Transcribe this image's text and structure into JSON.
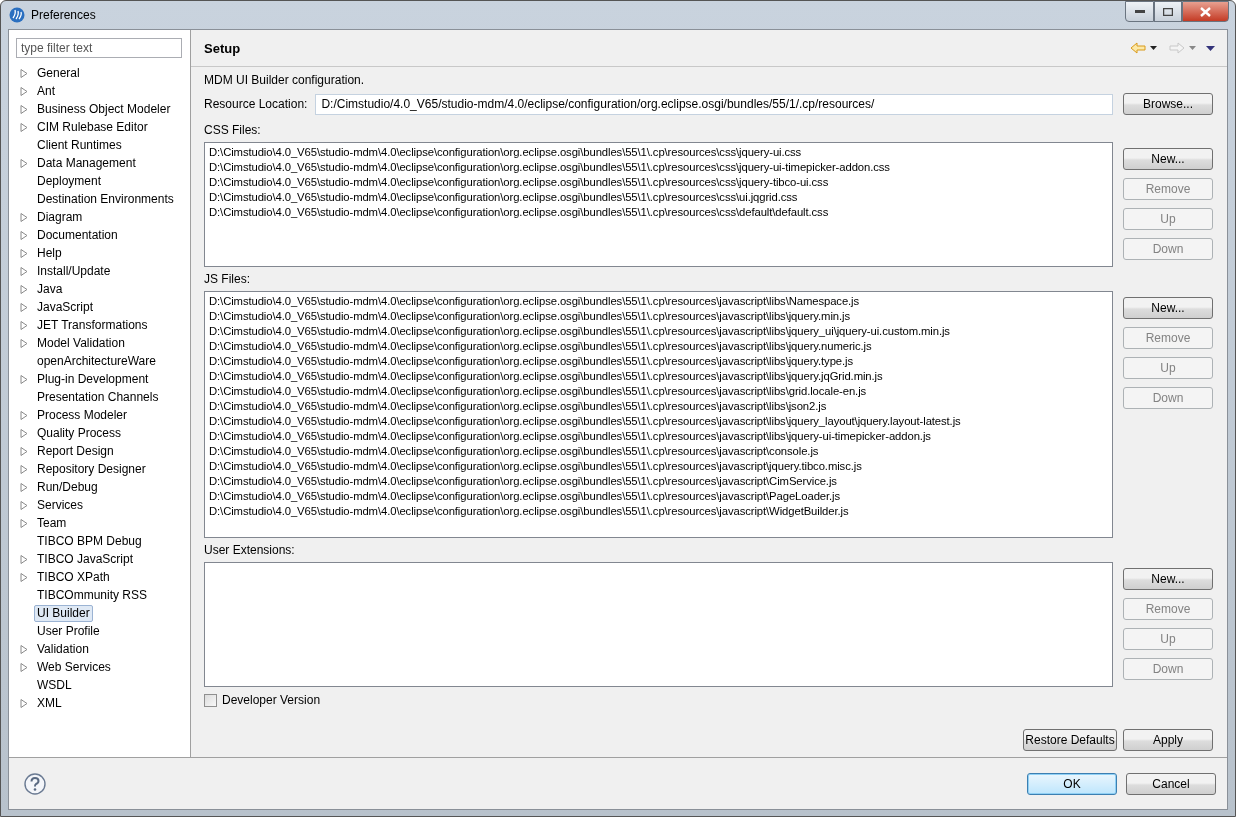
{
  "window": {
    "title": "Preferences"
  },
  "filter": {
    "placeholder": "type filter text"
  },
  "tree": [
    {
      "label": "General",
      "expandable": true,
      "selected": false
    },
    {
      "label": "Ant",
      "expandable": true,
      "selected": false
    },
    {
      "label": "Business Object Modeler",
      "expandable": true,
      "selected": false
    },
    {
      "label": "CIM Rulebase Editor",
      "expandable": true,
      "selected": false
    },
    {
      "label": "Client Runtimes",
      "expandable": false,
      "selected": false
    },
    {
      "label": "Data Management",
      "expandable": true,
      "selected": false
    },
    {
      "label": "Deployment",
      "expandable": false,
      "selected": false
    },
    {
      "label": "Destination Environments",
      "expandable": false,
      "selected": false
    },
    {
      "label": "Diagram",
      "expandable": true,
      "selected": false
    },
    {
      "label": "Documentation",
      "expandable": true,
      "selected": false
    },
    {
      "label": "Help",
      "expandable": true,
      "selected": false
    },
    {
      "label": "Install/Update",
      "expandable": true,
      "selected": false
    },
    {
      "label": "Java",
      "expandable": true,
      "selected": false
    },
    {
      "label": "JavaScript",
      "expandable": true,
      "selected": false
    },
    {
      "label": "JET Transformations",
      "expandable": true,
      "selected": false
    },
    {
      "label": "Model Validation",
      "expandable": true,
      "selected": false
    },
    {
      "label": "openArchitectureWare",
      "expandable": false,
      "selected": false
    },
    {
      "label": "Plug-in Development",
      "expandable": true,
      "selected": false
    },
    {
      "label": "Presentation Channels",
      "expandable": false,
      "selected": false
    },
    {
      "label": "Process Modeler",
      "expandable": true,
      "selected": false
    },
    {
      "label": "Quality Process",
      "expandable": true,
      "selected": false
    },
    {
      "label": "Report Design",
      "expandable": true,
      "selected": false
    },
    {
      "label": "Repository Designer",
      "expandable": true,
      "selected": false
    },
    {
      "label": "Run/Debug",
      "expandable": true,
      "selected": false
    },
    {
      "label": "Services",
      "expandable": true,
      "selected": false
    },
    {
      "label": "Team",
      "expandable": true,
      "selected": false
    },
    {
      "label": "TIBCO BPM Debug",
      "expandable": false,
      "selected": false
    },
    {
      "label": "TIBCO JavaScript",
      "expandable": true,
      "selected": false
    },
    {
      "label": "TIBCO XPath",
      "expandable": true,
      "selected": false
    },
    {
      "label": "TIBCOmmunity RSS",
      "expandable": false,
      "selected": false
    },
    {
      "label": "UI Builder",
      "expandable": false,
      "selected": true
    },
    {
      "label": "User Profile",
      "expandable": false,
      "selected": false
    },
    {
      "label": "Validation",
      "expandable": true,
      "selected": false
    },
    {
      "label": "Web Services",
      "expandable": true,
      "selected": false
    },
    {
      "label": "WSDL",
      "expandable": false,
      "selected": false
    },
    {
      "label": "XML",
      "expandable": true,
      "selected": false
    }
  ],
  "page": {
    "title": "Setup",
    "description": "MDM UI Builder configuration.",
    "resource_location": {
      "label": "Resource Location:",
      "value": "D:/Cimstudio/4.0_V65/studio-mdm/4.0/eclipse/configuration/org.eclipse.osgi/bundles/55/1/.cp/resources/"
    },
    "browse_button": "Browse...",
    "sections": [
      {
        "label": "CSS Files:",
        "items": [
          "D:\\Cimstudio\\4.0_V65\\studio-mdm\\4.0\\eclipse\\configuration\\org.eclipse.osgi\\bundles\\55\\1\\.cp\\resources\\css\\jquery-ui.css",
          "D:\\Cimstudio\\4.0_V65\\studio-mdm\\4.0\\eclipse\\configuration\\org.eclipse.osgi\\bundles\\55\\1\\.cp\\resources\\css\\jquery-ui-timepicker-addon.css",
          "D:\\Cimstudio\\4.0_V65\\studio-mdm\\4.0\\eclipse\\configuration\\org.eclipse.osgi\\bundles\\55\\1\\.cp\\resources\\css\\jquery-tibco-ui.css",
          "D:\\Cimstudio\\4.0_V65\\studio-mdm\\4.0\\eclipse\\configuration\\org.eclipse.osgi\\bundles\\55\\1\\.cp\\resources\\css\\ui.jqgrid.css",
          "D:\\Cimstudio\\4.0_V65\\studio-mdm\\4.0\\eclipse\\configuration\\org.eclipse.osgi\\bundles\\55\\1\\.cp\\resources\\css\\default\\default.css"
        ],
        "buttons": [
          {
            "label": "New...",
            "disabled": false
          },
          {
            "label": "Remove",
            "disabled": true
          },
          {
            "label": "Up",
            "disabled": true
          },
          {
            "label": "Down",
            "disabled": true
          }
        ]
      },
      {
        "label": "JS Files:",
        "items": [
          "D:\\Cimstudio\\4.0_V65\\studio-mdm\\4.0\\eclipse\\configuration\\org.eclipse.osgi\\bundles\\55\\1\\.cp\\resources\\javascript\\libs\\Namespace.js",
          "D:\\Cimstudio\\4.0_V65\\studio-mdm\\4.0\\eclipse\\configuration\\org.eclipse.osgi\\bundles\\55\\1\\.cp\\resources\\javascript\\libs\\jquery.min.js",
          "D:\\Cimstudio\\4.0_V65\\studio-mdm\\4.0\\eclipse\\configuration\\org.eclipse.osgi\\bundles\\55\\1\\.cp\\resources\\javascript\\libs\\jquery_ui\\jquery-ui.custom.min.js",
          "D:\\Cimstudio\\4.0_V65\\studio-mdm\\4.0\\eclipse\\configuration\\org.eclipse.osgi\\bundles\\55\\1\\.cp\\resources\\javascript\\libs\\jquery.numeric.js",
          "D:\\Cimstudio\\4.0_V65\\studio-mdm\\4.0\\eclipse\\configuration\\org.eclipse.osgi\\bundles\\55\\1\\.cp\\resources\\javascript\\libs\\jquery.type.js",
          "D:\\Cimstudio\\4.0_V65\\studio-mdm\\4.0\\eclipse\\configuration\\org.eclipse.osgi\\bundles\\55\\1\\.cp\\resources\\javascript\\libs\\jquery.jqGrid.min.js",
          "D:\\Cimstudio\\4.0_V65\\studio-mdm\\4.0\\eclipse\\configuration\\org.eclipse.osgi\\bundles\\55\\1\\.cp\\resources\\javascript\\libs\\grid.locale-en.js",
          "D:\\Cimstudio\\4.0_V65\\studio-mdm\\4.0\\eclipse\\configuration\\org.eclipse.osgi\\bundles\\55\\1\\.cp\\resources\\javascript\\libs\\json2.js",
          "D:\\Cimstudio\\4.0_V65\\studio-mdm\\4.0\\eclipse\\configuration\\org.eclipse.osgi\\bundles\\55\\1\\.cp\\resources\\javascript\\libs\\jquery_layout\\jquery.layout-latest.js",
          "D:\\Cimstudio\\4.0_V65\\studio-mdm\\4.0\\eclipse\\configuration\\org.eclipse.osgi\\bundles\\55\\1\\.cp\\resources\\javascript\\libs\\jquery-ui-timepicker-addon.js",
          "D:\\Cimstudio\\4.0_V65\\studio-mdm\\4.0\\eclipse\\configuration\\org.eclipse.osgi\\bundles\\55\\1\\.cp\\resources\\javascript\\console.js",
          "D:\\Cimstudio\\4.0_V65\\studio-mdm\\4.0\\eclipse\\configuration\\org.eclipse.osgi\\bundles\\55\\1\\.cp\\resources\\javascript\\jquery.tibco.misc.js",
          "D:\\Cimstudio\\4.0_V65\\studio-mdm\\4.0\\eclipse\\configuration\\org.eclipse.osgi\\bundles\\55\\1\\.cp\\resources\\javascript\\CimService.js",
          "D:\\Cimstudio\\4.0_V65\\studio-mdm\\4.0\\eclipse\\configuration\\org.eclipse.osgi\\bundles\\55\\1\\.cp\\resources\\javascript\\PageLoader.js",
          "D:\\Cimstudio\\4.0_V65\\studio-mdm\\4.0\\eclipse\\configuration\\org.eclipse.osgi\\bundles\\55\\1\\.cp\\resources\\javascript\\WidgetBuilder.js"
        ],
        "buttons": [
          {
            "label": "New...",
            "disabled": false
          },
          {
            "label": "Remove",
            "disabled": true
          },
          {
            "label": "Up",
            "disabled": true
          },
          {
            "label": "Down",
            "disabled": true
          }
        ]
      },
      {
        "label": "User Extensions:",
        "buttons": [
          {
            "label": "New...",
            "disabled": false
          },
          {
            "label": "Remove",
            "disabled": true
          },
          {
            "label": "Up",
            "disabled": true
          },
          {
            "label": "Down",
            "disabled": true
          }
        ]
      }
    ],
    "developer_version": {
      "label": "Developer Version",
      "checked": false
    },
    "restore_defaults": "Restore Defaults",
    "apply": "Apply"
  },
  "footer": {
    "ok": "OK",
    "cancel": "Cancel"
  }
}
